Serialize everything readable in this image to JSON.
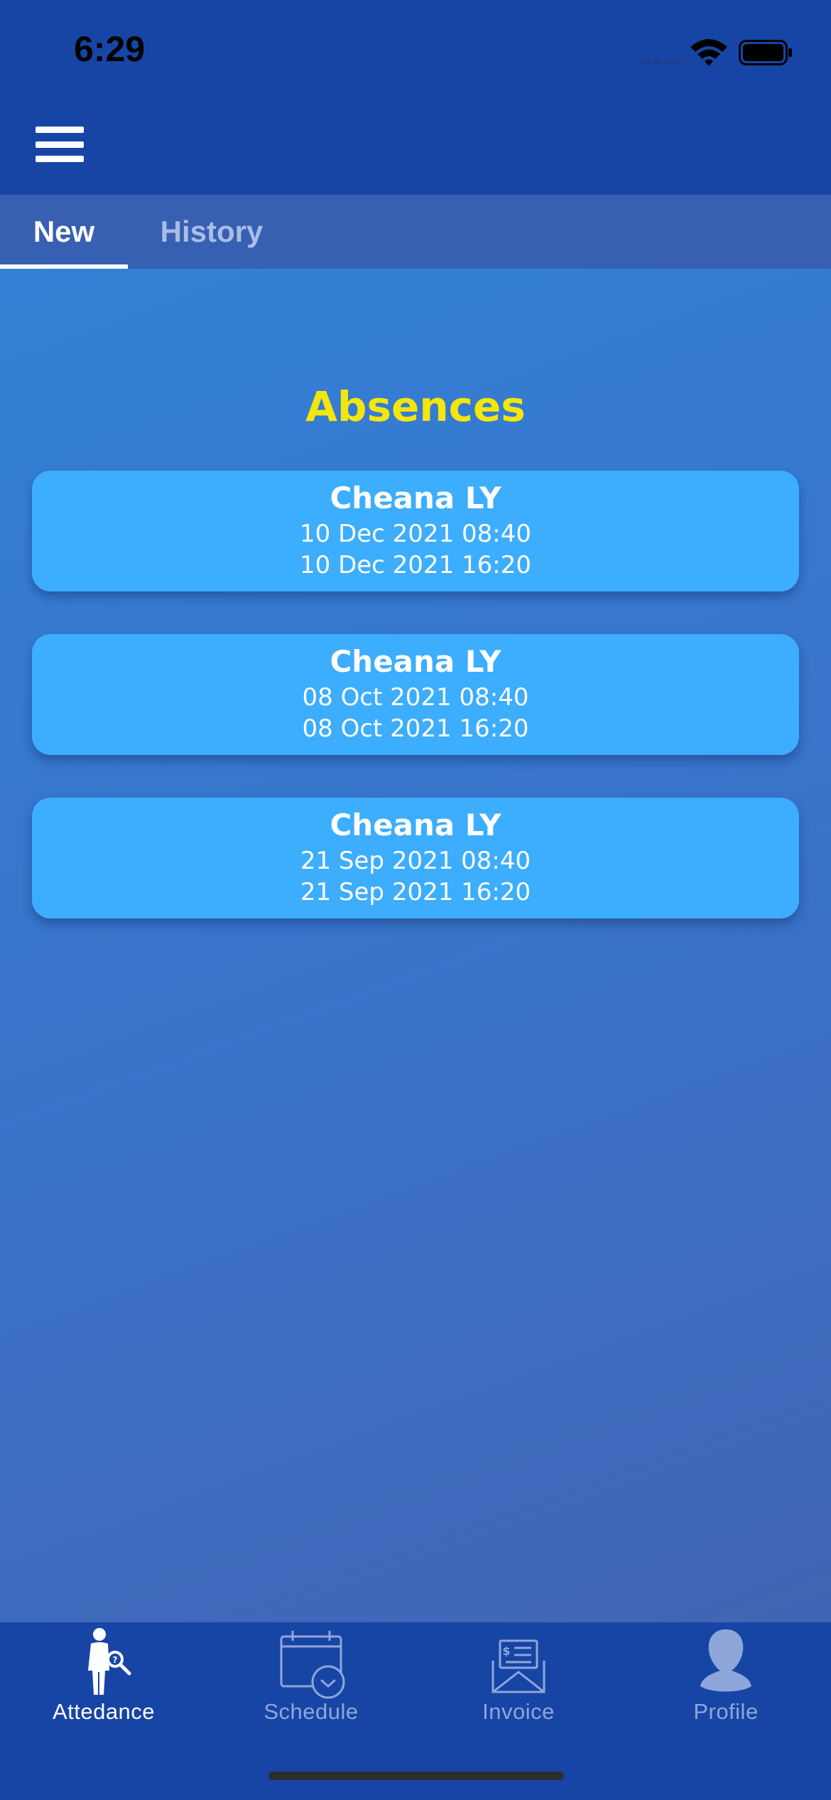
{
  "status_bar": {
    "time": "6:29",
    "icons": [
      "cellular-signal-icon",
      "wifi-icon",
      "battery-icon"
    ]
  },
  "header": {
    "menu_icon": "hamburger-menu-icon"
  },
  "tabs": [
    {
      "label": "New",
      "selected": true
    },
    {
      "label": "History",
      "selected": false
    }
  ],
  "main": {
    "title": "Absences",
    "absences": [
      {
        "name": "Cheana LY",
        "start": "10 Dec 2021 08:40",
        "end": "10 Dec 2021 16:20"
      },
      {
        "name": "Cheana LY",
        "start": "08 Oct 2021 08:40",
        "end": "08 Oct 2021 16:20"
      },
      {
        "name": "Cheana LY",
        "start": "21 Sep 2021 08:40",
        "end": "21 Sep 2021 16:20"
      }
    ]
  },
  "bottom_nav": {
    "items": [
      {
        "label": "Attedance",
        "icon": "attendance-person-icon",
        "active": true
      },
      {
        "label": "Schedule",
        "icon": "calendar-clock-icon",
        "active": false
      },
      {
        "label": "Invoice",
        "icon": "invoice-envelope-icon",
        "active": false
      },
      {
        "label": "Profile",
        "icon": "profile-avatar-icon",
        "active": false
      }
    ]
  },
  "colors": {
    "primary": "#1745a5",
    "tab_bar": "#3760b2",
    "card": "#3dadfe",
    "title": "#f4e60c",
    "inactive": "#8fa6da"
  }
}
